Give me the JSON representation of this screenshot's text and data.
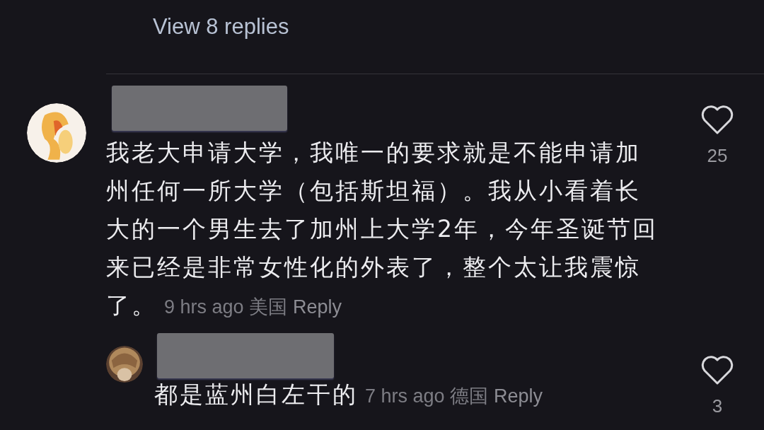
{
  "view_replies": "View 8 replies",
  "comments": [
    {
      "text": "我老大申请大学，我唯一的要求就是不能申请加州任何一所大学（包括斯坦福）。我从小看着长大的一个男生去了加州上大学2年，今年圣诞节回来已经是非常女性化的外表了，整个太让我震惊了。",
      "time": "9 hrs ago",
      "location": "美国",
      "reply": "Reply",
      "likes": "25",
      "kind": "top"
    },
    {
      "text": "都是蓝州白左干的",
      "time": "7 hrs ago",
      "location": "德国",
      "reply": "Reply",
      "likes": "3",
      "kind": "reply"
    }
  ]
}
